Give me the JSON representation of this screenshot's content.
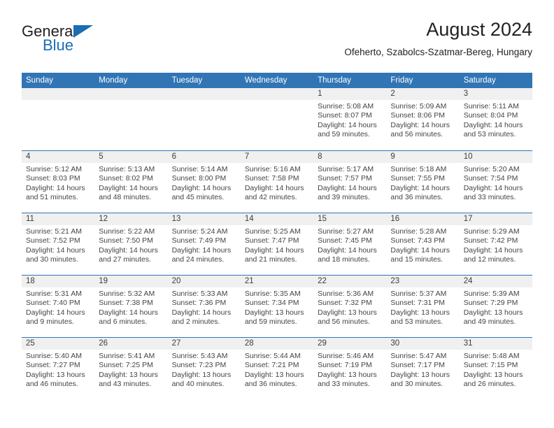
{
  "brand": {
    "name_part1": "General",
    "name_part2": "Blue",
    "triangle_color": "#1b6cb5"
  },
  "header": {
    "title": "August 2024",
    "subtitle": "Ofeherto, Szabolcs-Szatmar-Bereg, Hungary"
  },
  "theme": {
    "header_blue": "#3175b5",
    "daynum_band": "#f0f0f0",
    "text": "#444444"
  },
  "weekdays": [
    "Sunday",
    "Monday",
    "Tuesday",
    "Wednesday",
    "Thursday",
    "Friday",
    "Saturday"
  ],
  "weeks": [
    [
      {
        "day": "",
        "sunrise": "",
        "sunset": "",
        "daylight1": "",
        "daylight2": ""
      },
      {
        "day": "",
        "sunrise": "",
        "sunset": "",
        "daylight1": "",
        "daylight2": ""
      },
      {
        "day": "",
        "sunrise": "",
        "sunset": "",
        "daylight1": "",
        "daylight2": ""
      },
      {
        "day": "",
        "sunrise": "",
        "sunset": "",
        "daylight1": "",
        "daylight2": ""
      },
      {
        "day": "1",
        "sunrise": "Sunrise: 5:08 AM",
        "sunset": "Sunset: 8:07 PM",
        "daylight1": "Daylight: 14 hours",
        "daylight2": "and 59 minutes."
      },
      {
        "day": "2",
        "sunrise": "Sunrise: 5:09 AM",
        "sunset": "Sunset: 8:06 PM",
        "daylight1": "Daylight: 14 hours",
        "daylight2": "and 56 minutes."
      },
      {
        "day": "3",
        "sunrise": "Sunrise: 5:11 AM",
        "sunset": "Sunset: 8:04 PM",
        "daylight1": "Daylight: 14 hours",
        "daylight2": "and 53 minutes."
      }
    ],
    [
      {
        "day": "4",
        "sunrise": "Sunrise: 5:12 AM",
        "sunset": "Sunset: 8:03 PM",
        "daylight1": "Daylight: 14 hours",
        "daylight2": "and 51 minutes."
      },
      {
        "day": "5",
        "sunrise": "Sunrise: 5:13 AM",
        "sunset": "Sunset: 8:02 PM",
        "daylight1": "Daylight: 14 hours",
        "daylight2": "and 48 minutes."
      },
      {
        "day": "6",
        "sunrise": "Sunrise: 5:14 AM",
        "sunset": "Sunset: 8:00 PM",
        "daylight1": "Daylight: 14 hours",
        "daylight2": "and 45 minutes."
      },
      {
        "day": "7",
        "sunrise": "Sunrise: 5:16 AM",
        "sunset": "Sunset: 7:58 PM",
        "daylight1": "Daylight: 14 hours",
        "daylight2": "and 42 minutes."
      },
      {
        "day": "8",
        "sunrise": "Sunrise: 5:17 AM",
        "sunset": "Sunset: 7:57 PM",
        "daylight1": "Daylight: 14 hours",
        "daylight2": "and 39 minutes."
      },
      {
        "day": "9",
        "sunrise": "Sunrise: 5:18 AM",
        "sunset": "Sunset: 7:55 PM",
        "daylight1": "Daylight: 14 hours",
        "daylight2": "and 36 minutes."
      },
      {
        "day": "10",
        "sunrise": "Sunrise: 5:20 AM",
        "sunset": "Sunset: 7:54 PM",
        "daylight1": "Daylight: 14 hours",
        "daylight2": "and 33 minutes."
      }
    ],
    [
      {
        "day": "11",
        "sunrise": "Sunrise: 5:21 AM",
        "sunset": "Sunset: 7:52 PM",
        "daylight1": "Daylight: 14 hours",
        "daylight2": "and 30 minutes."
      },
      {
        "day": "12",
        "sunrise": "Sunrise: 5:22 AM",
        "sunset": "Sunset: 7:50 PM",
        "daylight1": "Daylight: 14 hours",
        "daylight2": "and 27 minutes."
      },
      {
        "day": "13",
        "sunrise": "Sunrise: 5:24 AM",
        "sunset": "Sunset: 7:49 PM",
        "daylight1": "Daylight: 14 hours",
        "daylight2": "and 24 minutes."
      },
      {
        "day": "14",
        "sunrise": "Sunrise: 5:25 AM",
        "sunset": "Sunset: 7:47 PM",
        "daylight1": "Daylight: 14 hours",
        "daylight2": "and 21 minutes."
      },
      {
        "day": "15",
        "sunrise": "Sunrise: 5:27 AM",
        "sunset": "Sunset: 7:45 PM",
        "daylight1": "Daylight: 14 hours",
        "daylight2": "and 18 minutes."
      },
      {
        "day": "16",
        "sunrise": "Sunrise: 5:28 AM",
        "sunset": "Sunset: 7:43 PM",
        "daylight1": "Daylight: 14 hours",
        "daylight2": "and 15 minutes."
      },
      {
        "day": "17",
        "sunrise": "Sunrise: 5:29 AM",
        "sunset": "Sunset: 7:42 PM",
        "daylight1": "Daylight: 14 hours",
        "daylight2": "and 12 minutes."
      }
    ],
    [
      {
        "day": "18",
        "sunrise": "Sunrise: 5:31 AM",
        "sunset": "Sunset: 7:40 PM",
        "daylight1": "Daylight: 14 hours",
        "daylight2": "and 9 minutes."
      },
      {
        "day": "19",
        "sunrise": "Sunrise: 5:32 AM",
        "sunset": "Sunset: 7:38 PM",
        "daylight1": "Daylight: 14 hours",
        "daylight2": "and 6 minutes."
      },
      {
        "day": "20",
        "sunrise": "Sunrise: 5:33 AM",
        "sunset": "Sunset: 7:36 PM",
        "daylight1": "Daylight: 14 hours",
        "daylight2": "and 2 minutes."
      },
      {
        "day": "21",
        "sunrise": "Sunrise: 5:35 AM",
        "sunset": "Sunset: 7:34 PM",
        "daylight1": "Daylight: 13 hours",
        "daylight2": "and 59 minutes."
      },
      {
        "day": "22",
        "sunrise": "Sunrise: 5:36 AM",
        "sunset": "Sunset: 7:32 PM",
        "daylight1": "Daylight: 13 hours",
        "daylight2": "and 56 minutes."
      },
      {
        "day": "23",
        "sunrise": "Sunrise: 5:37 AM",
        "sunset": "Sunset: 7:31 PM",
        "daylight1": "Daylight: 13 hours",
        "daylight2": "and 53 minutes."
      },
      {
        "day": "24",
        "sunrise": "Sunrise: 5:39 AM",
        "sunset": "Sunset: 7:29 PM",
        "daylight1": "Daylight: 13 hours",
        "daylight2": "and 49 minutes."
      }
    ],
    [
      {
        "day": "25",
        "sunrise": "Sunrise: 5:40 AM",
        "sunset": "Sunset: 7:27 PM",
        "daylight1": "Daylight: 13 hours",
        "daylight2": "and 46 minutes."
      },
      {
        "day": "26",
        "sunrise": "Sunrise: 5:41 AM",
        "sunset": "Sunset: 7:25 PM",
        "daylight1": "Daylight: 13 hours",
        "daylight2": "and 43 minutes."
      },
      {
        "day": "27",
        "sunrise": "Sunrise: 5:43 AM",
        "sunset": "Sunset: 7:23 PM",
        "daylight1": "Daylight: 13 hours",
        "daylight2": "and 40 minutes."
      },
      {
        "day": "28",
        "sunrise": "Sunrise: 5:44 AM",
        "sunset": "Sunset: 7:21 PM",
        "daylight1": "Daylight: 13 hours",
        "daylight2": "and 36 minutes."
      },
      {
        "day": "29",
        "sunrise": "Sunrise: 5:46 AM",
        "sunset": "Sunset: 7:19 PM",
        "daylight1": "Daylight: 13 hours",
        "daylight2": "and 33 minutes."
      },
      {
        "day": "30",
        "sunrise": "Sunrise: 5:47 AM",
        "sunset": "Sunset: 7:17 PM",
        "daylight1": "Daylight: 13 hours",
        "daylight2": "and 30 minutes."
      },
      {
        "day": "31",
        "sunrise": "Sunrise: 5:48 AM",
        "sunset": "Sunset: 7:15 PM",
        "daylight1": "Daylight: 13 hours",
        "daylight2": "and 26 minutes."
      }
    ]
  ]
}
